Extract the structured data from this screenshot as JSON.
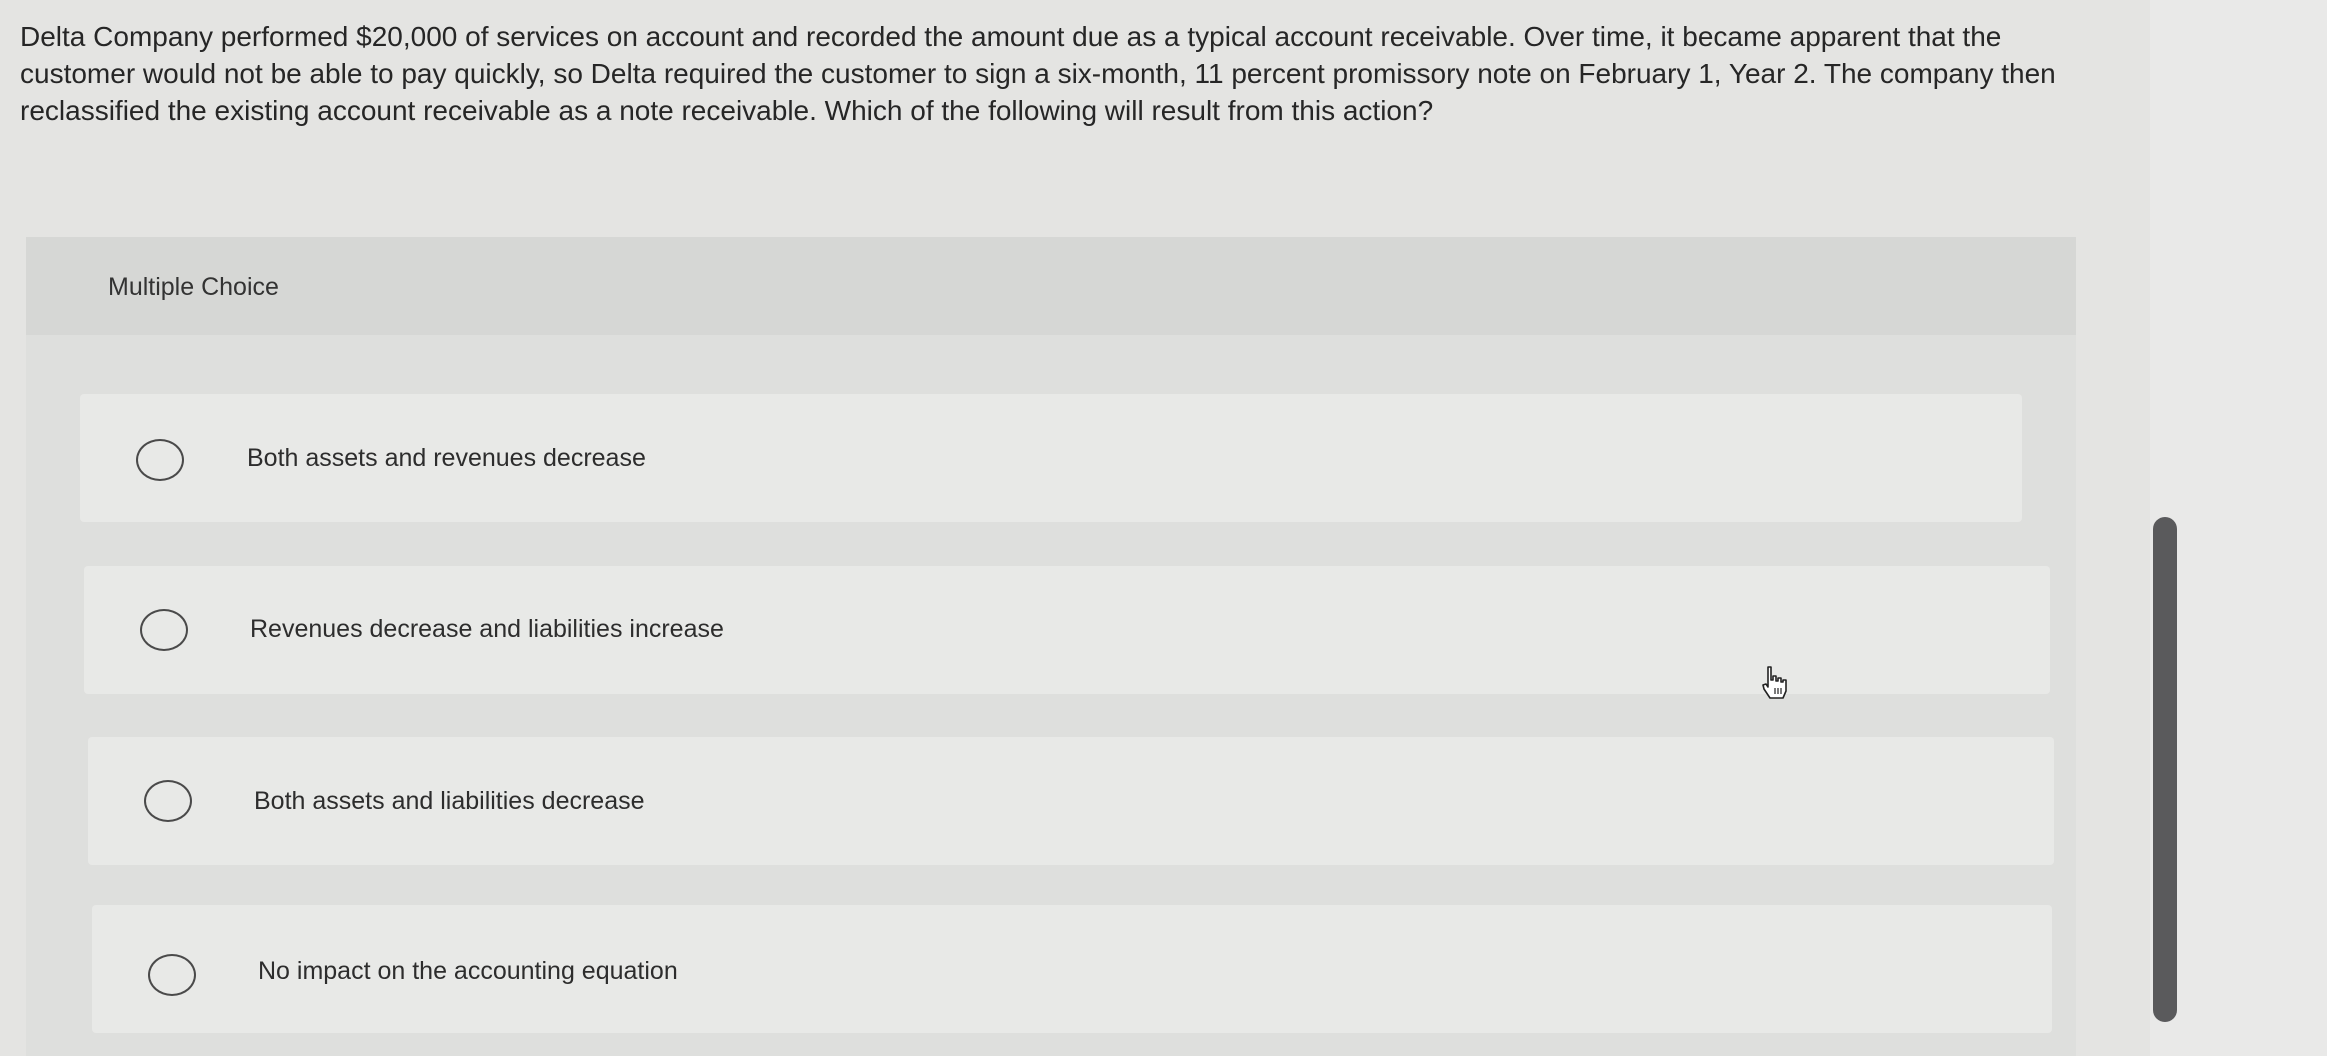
{
  "question": {
    "text": "Delta Company performed $20,000 of services on account and recorded the amount due as a typical account receivable. Over time, it became apparent that the customer would not be able to pay quickly, so Delta required the customer to sign a six-month, 11 percent promissory note on February 1, Year 2. The company then reclassified the existing account receivable as a note receivable. Which of the following will result from this action?"
  },
  "multiple_choice": {
    "label": "Multiple Choice",
    "choices": [
      {
        "label": "Both assets and revenues decrease",
        "selected": false
      },
      {
        "label": "Revenues decrease and liabilities increase",
        "selected": false
      },
      {
        "label": "Both assets and liabilities decrease",
        "selected": false
      },
      {
        "label": "No impact on the accounting equation",
        "selected": false
      }
    ]
  },
  "icons": {
    "cursor": "hand-pointer-icon",
    "radio": "radio-button-icon"
  }
}
